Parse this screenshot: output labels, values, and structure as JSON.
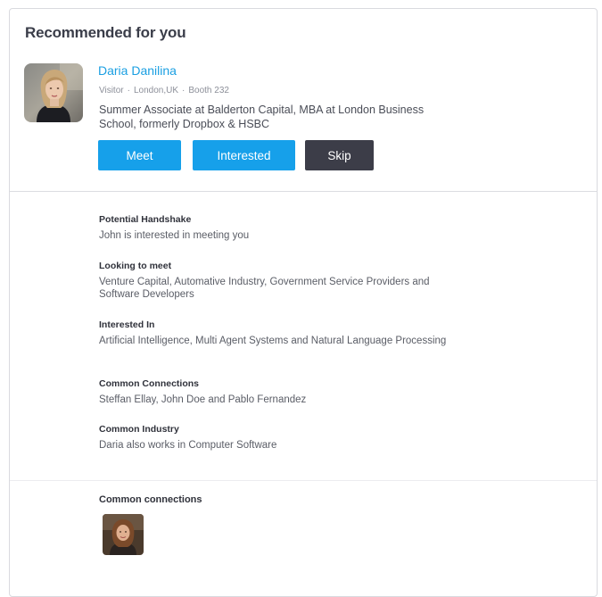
{
  "card": {
    "title": "Recommended for you"
  },
  "person": {
    "name": "Daria Danilina",
    "role": "Visitor",
    "location": "London,UK",
    "booth": "Booth 232",
    "separator": "·",
    "headline": "Summer Associate at Balderton Capital, MBA at London Business School, formerly Dropbox & HSBC"
  },
  "actions": {
    "meet_label": "Meet",
    "interested_label": "Interested",
    "skip_label": "Skip"
  },
  "details": [
    {
      "label": "Potential Handshake",
      "value": "John is interested in meeting you"
    },
    {
      "label": "Looking to meet",
      "value": "Venture Capital, Automative Industry, Government Service Providers and Software Developers"
    },
    {
      "label": "Interested In",
      "value": "Artificial Intelligence, Multi Agent Systems and Natural Language Processing"
    },
    {
      "label": "Common Connections",
      "value": "Steffan Ellay, John Doe and Pablo Fernandez"
    },
    {
      "label": "Common Industry",
      "value": "Daria also works in Computer Software"
    }
  ],
  "common_connections": {
    "label": "Common connections",
    "count": 1
  },
  "colors": {
    "link": "#1a9fe2",
    "primary_button": "#16a0ea",
    "skip_button": "#3c3d48"
  }
}
